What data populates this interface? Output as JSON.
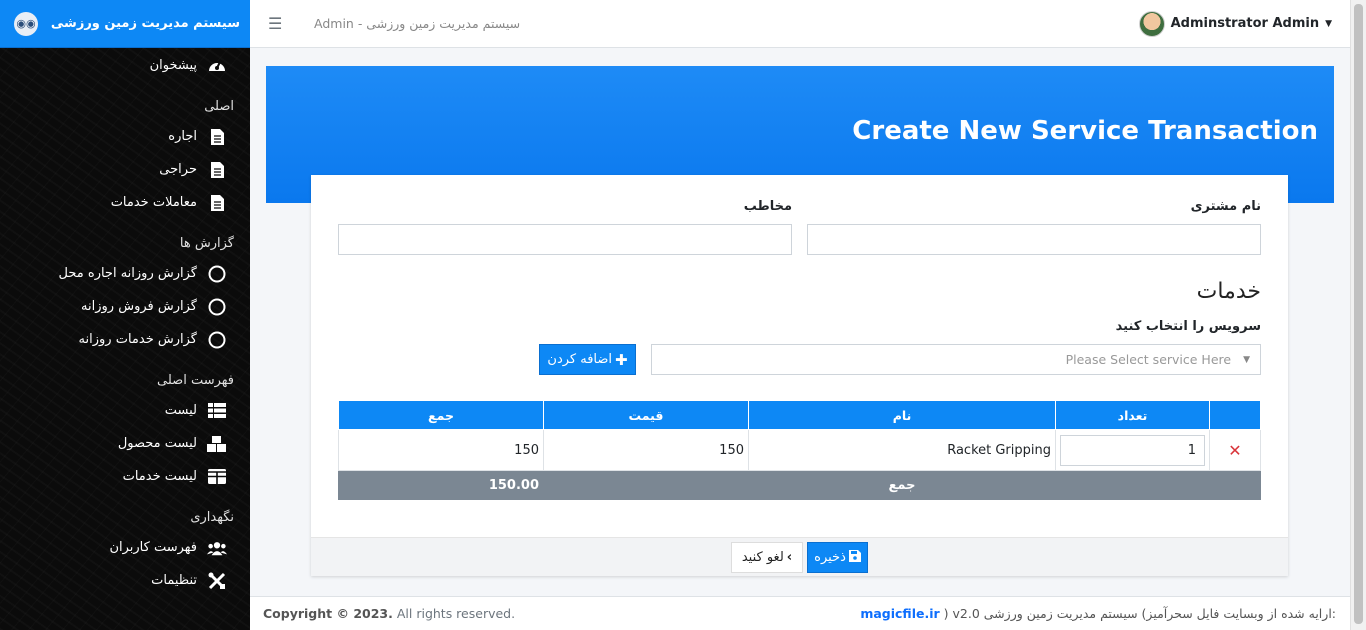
{
  "brand": {
    "title": "سیستم مدیریت زمین ورزشی"
  },
  "sidebar": {
    "items": [
      {
        "type": "item",
        "label": "پیشخوان",
        "icon": "dashboard-icon"
      },
      {
        "type": "header",
        "label": "اصلی"
      },
      {
        "type": "item",
        "label": "اجاره",
        "icon": "file-icon"
      },
      {
        "type": "item",
        "label": "حراجی",
        "icon": "file-icon"
      },
      {
        "type": "item",
        "label": "معاملات خدمات",
        "icon": "file-icon"
      },
      {
        "type": "header",
        "label": "گزارش ها"
      },
      {
        "type": "item",
        "label": "گزارش روزانه اجاره محل",
        "icon": "circle-icon"
      },
      {
        "type": "item",
        "label": "گزارش فروش روزانه",
        "icon": "circle-icon"
      },
      {
        "type": "item",
        "label": "گزارش خدمات روزانه",
        "icon": "circle-icon"
      },
      {
        "type": "header",
        "label": "فهرست اصلی"
      },
      {
        "type": "item",
        "label": "لیست",
        "icon": "list-icon"
      },
      {
        "type": "item",
        "label": "لیست محصول",
        "icon": "boxes-icon"
      },
      {
        "type": "item",
        "label": "لیست خدمات",
        "icon": "table-icon"
      },
      {
        "type": "header",
        "label": "نگهداری"
      },
      {
        "type": "item",
        "label": "فهرست کاربران",
        "icon": "users-icon"
      },
      {
        "type": "item",
        "label": "تنظیمات",
        "icon": "tools-icon"
      }
    ]
  },
  "topbar": {
    "title": "سیستم مدیریت زمین ورزشی - Admin",
    "user": "Adminstrator Admin"
  },
  "page": {
    "heading": "Create New Service Transaction"
  },
  "form": {
    "customer_label": "نام مشتری",
    "customer_value": "",
    "contact_label": "مخاطب",
    "contact_value": "",
    "services_title": "خدمات",
    "select_label": "سرویس را انتخاب کنید",
    "select_placeholder": "Please Select service Here",
    "add_button": "اضافه کردن"
  },
  "table": {
    "headers": {
      "qty": "تعداد",
      "name": "نام",
      "price": "قیمت",
      "total": "جمع"
    },
    "rows": [
      {
        "qty": "1",
        "name": "Racket Gripping",
        "price": "150",
        "total": "150"
      }
    ],
    "total_label": "جمع",
    "total_value": "150.00"
  },
  "actions": {
    "save": "ذخیره",
    "cancel": "لغو کنید"
  },
  "footer": {
    "copyright": "Copyright © 2023.",
    "rights": "All rights reserved.",
    "credit_text": ":ارایه شده از وبسایت فایل سحرآمیز) سیستم مدیریت زمین ورزشی",
    "credit_link": "magicfile.ir",
    "version": ") v2.0"
  },
  "colors": {
    "primary": "#0d88f5",
    "danger": "#d9343a",
    "total_row": "#7b8793"
  }
}
